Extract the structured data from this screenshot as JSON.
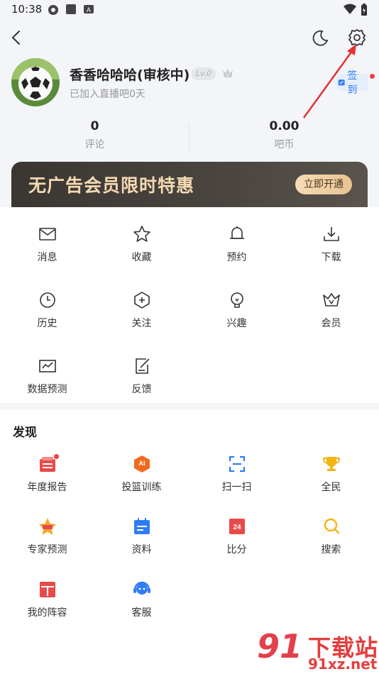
{
  "status_bar": {
    "time": "10:38"
  },
  "profile": {
    "username": "香香哈哈哈(审核中)",
    "level": "Lv.0",
    "join_text": "已加入直播吧0天",
    "checkin_label": "签到"
  },
  "stats": [
    {
      "value": "0",
      "label": "评论"
    },
    {
      "value": "0.00",
      "label": "吧币"
    }
  ],
  "banner": {
    "title": "无广告会员限时特惠",
    "button": "立即开通"
  },
  "menu": [
    {
      "label": "消息",
      "icon": "mail-icon"
    },
    {
      "label": "收藏",
      "icon": "star-icon"
    },
    {
      "label": "预约",
      "icon": "bell-icon"
    },
    {
      "label": "下载",
      "icon": "download-icon"
    },
    {
      "label": "历史",
      "icon": "clock-icon"
    },
    {
      "label": "关注",
      "icon": "plus-hexagon-icon"
    },
    {
      "label": "兴趣",
      "icon": "bulb-icon"
    },
    {
      "label": "会员",
      "icon": "crown-icon"
    },
    {
      "label": "数据预测",
      "icon": "chart-icon"
    },
    {
      "label": "反馈",
      "icon": "feedback-icon"
    }
  ],
  "discover": {
    "title": "发现",
    "items": [
      {
        "label": "年度报告",
        "icon": "report-icon",
        "color": "#e84a4a"
      },
      {
        "label": "投篮训练",
        "icon": "ai-shoot-icon",
        "color": "#f06a1e"
      },
      {
        "label": "扫一扫",
        "icon": "scan-icon",
        "color": "#2f7cf6"
      },
      {
        "label": "全民",
        "icon": "trophy-icon",
        "color": "#f5b314"
      },
      {
        "label": "专家预测",
        "icon": "expert-star-icon",
        "color": "#f5a623"
      },
      {
        "label": "资料",
        "icon": "calendar-icon",
        "color": "#2f7cf6"
      },
      {
        "label": "比分",
        "icon": "score-icon",
        "color": "#e84a4a"
      },
      {
        "label": "搜索",
        "icon": "search-icon",
        "color": "#f5b314"
      },
      {
        "label": "我的阵容",
        "icon": "lineup-icon",
        "color": "#e84a4a"
      },
      {
        "label": "客服",
        "icon": "support-icon",
        "color": "#2f7cf6"
      }
    ]
  },
  "watermark": {
    "number": "91",
    "title": "下载站",
    "site": "91xz.net"
  },
  "colors": {
    "accent": "#2f7cf6",
    "banner_gold": "#f4d9b3",
    "red": "#e53d3d"
  }
}
